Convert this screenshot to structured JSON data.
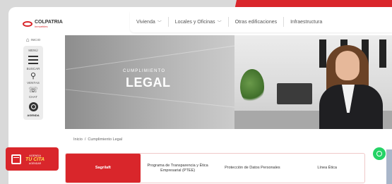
{
  "brand": {
    "name": "COLPATRIA",
    "sub": "Inmuebles"
  },
  "nav": [
    {
      "label": "Vivienda",
      "has_menu": true
    },
    {
      "label": "Locales y Oficinas",
      "has_menu": true
    },
    {
      "label": "Otras edificaciones",
      "has_menu": false
    },
    {
      "label": "Infraestructura",
      "has_menu": false
    }
  ],
  "rail": {
    "inicio": "INICIO",
    "menu": "MENÚ",
    "buscar": "BUSCAR",
    "ventas": "VENTAS",
    "chat": "CHAT",
    "bottom": "AGENDA"
  },
  "banner": {
    "subtitle": "CUMPLIMIENTO",
    "title": "LEGAL"
  },
  "breadcrumb": {
    "home": "Inicio",
    "sep": "/",
    "current": "Cumplimiento Legal"
  },
  "tabs": [
    {
      "label": "Sagrilaft",
      "active": true
    },
    {
      "label": "Programa de Transparencia y Ética Empresarial (PTEE)",
      "active": false
    },
    {
      "label": "Protección de Datos Personales",
      "active": false
    },
    {
      "label": "Línea Ética",
      "active": false
    }
  ],
  "promo": {
    "line1": "AGENDA",
    "line2": "TU CITA",
    "line3": "AGENDAR"
  },
  "colors": {
    "accent": "#d9262b",
    "whatsapp": "#25d366"
  }
}
